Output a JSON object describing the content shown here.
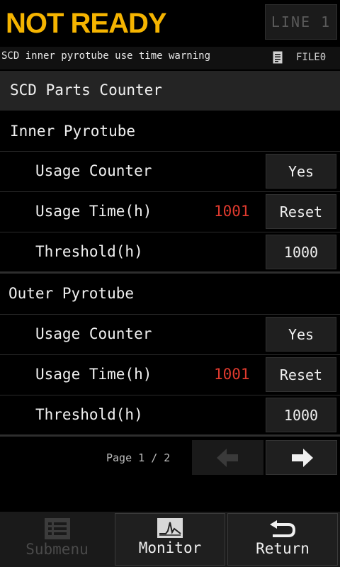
{
  "header": {
    "status": "NOT READY",
    "line_label": "LINE 1"
  },
  "info_bar": {
    "warning": "SCD inner pyrotube use time warning",
    "file_label": "FILE0",
    "file_icon": "document-icon"
  },
  "section": {
    "title": "SCD Parts Counter"
  },
  "groups": [
    {
      "title": "Inner Pyrotube",
      "usage_counter_label": "Usage Counter",
      "usage_counter_button": "Yes",
      "usage_time_label": "Usage Time(h)",
      "usage_time_value": "1001",
      "reset_button": "Reset",
      "threshold_label": "Threshold(h)",
      "threshold_value": "1000"
    },
    {
      "title": "Outer Pyrotube",
      "usage_counter_label": "Usage Counter",
      "usage_counter_button": "Yes",
      "usage_time_label": "Usage Time(h)",
      "usage_time_value": "1001",
      "reset_button": "Reset",
      "threshold_label": "Threshold(h)",
      "threshold_value": "1000"
    }
  ],
  "pagination": {
    "indicator": "Page 1 / 2",
    "prev_icon": "arrow-left-icon",
    "next_icon": "arrow-right-icon"
  },
  "footer": {
    "submenu_label": "Submenu",
    "monitor_label": "Monitor",
    "return_label": "Return"
  },
  "colors": {
    "status_accent": "#f5b400",
    "warning_value": "#e03a2e",
    "background": "#000000"
  }
}
